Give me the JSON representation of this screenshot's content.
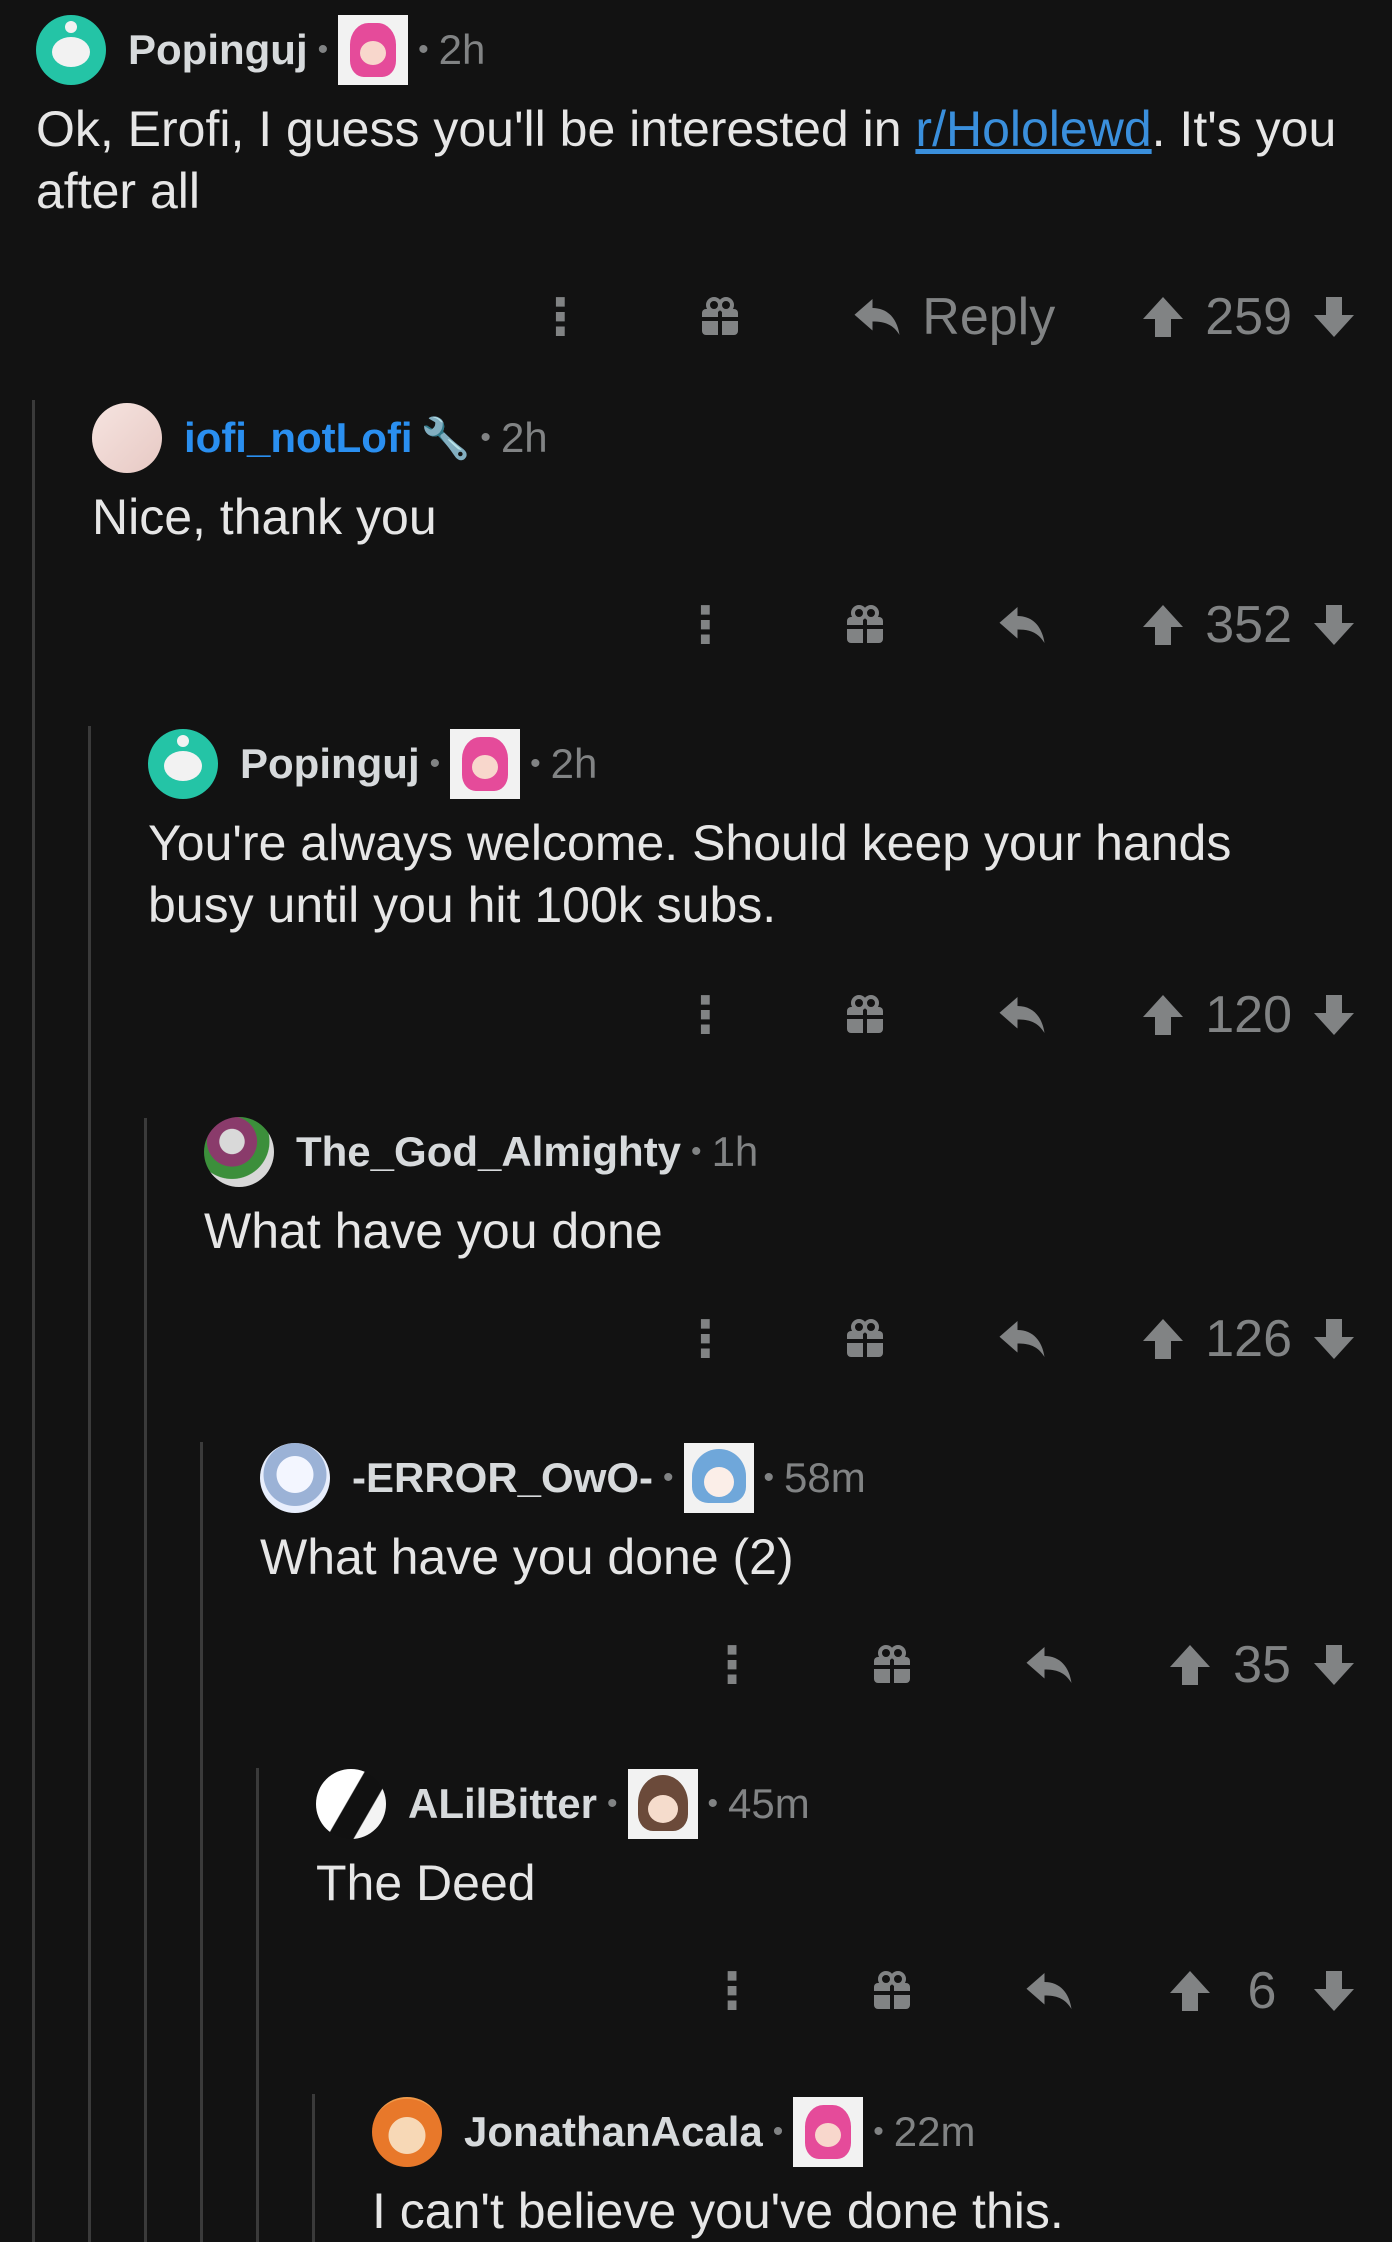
{
  "comments": [
    {
      "username": "Popinguj",
      "time": "2h",
      "body_pre": "Ok, Erofi, I guess you'll be interested in ",
      "body_link": "r/Hololewd",
      "body_post": ". It's you after all",
      "reply_label": "Reply",
      "score": "259"
    },
    {
      "username": "iofi_notLofi",
      "time": "2h",
      "body": "Nice, thank you",
      "score": "352"
    },
    {
      "username": "Popinguj",
      "time": "2h",
      "body": "You're always welcome. Should keep your hands busy until you hit 100k subs.",
      "score": "120"
    },
    {
      "username": "The_God_Almighty",
      "time": "1h",
      "body": "What have you done",
      "score": "126"
    },
    {
      "username": "-ERROR_OwO-",
      "time": "58m",
      "body": "What have you done (2)",
      "score": "35"
    },
    {
      "username": "ALilBitter",
      "time": "45m",
      "body": "The Deed",
      "score": "6"
    },
    {
      "username": "JonathanAcala",
      "time": "22m",
      "body": "I can't believe you've done this."
    }
  ],
  "dot": "•",
  "colors": {
    "background": "#121212",
    "op_username": "#2a8ff0",
    "link": "#3a8fdc",
    "meta": "#818384"
  },
  "icons": [
    "more-icon",
    "gift-icon",
    "reply-icon",
    "upvote-icon",
    "downvote-icon",
    "wrench-icon"
  ]
}
